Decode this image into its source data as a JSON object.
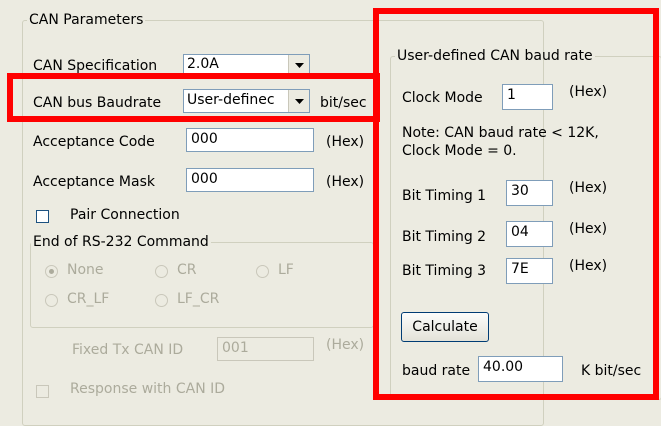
{
  "can_params": {
    "legend": "CAN Parameters",
    "spec_label": "CAN Specification",
    "spec_value": "2.0A",
    "baud_label": "CAN bus Baudrate",
    "baud_value": "User-definec",
    "baud_unit": "bit/sec",
    "acc_code_label": "Acceptance Code",
    "acc_code_value": "000",
    "acc_mask_label": "Acceptance Mask",
    "acc_mask_value": "000",
    "hex_unit": "(Hex)",
    "pair_label": "Pair Connection",
    "rs232": {
      "legend": "End of RS-232 Command",
      "opt_none": "None",
      "opt_cr": "CR",
      "opt_lf": "LF",
      "opt_cr_lf": "CR_LF",
      "opt_lf_cr": "LF_CR"
    },
    "fixed_tx_label": "Fixed Tx CAN ID",
    "fixed_tx_value": "001",
    "response_label": "Response with CAN ID"
  },
  "user_baud": {
    "legend": "User-defined CAN baud rate",
    "clock_label": "Clock Mode",
    "clock_value": "1",
    "hex_unit": "(Hex)",
    "note": "Note: CAN baud rate < 12K,\nClock Mode = 0.",
    "bt1_label": "Bit Timing 1",
    "bt1_value": "30",
    "bt2_label": "Bit Timing 2",
    "bt2_value": "04",
    "bt3_label": "Bit Timing 3",
    "bt3_value": "7E",
    "calc_label": "Calculate",
    "baud_label": "baud rate",
    "baud_value": "40.00",
    "baud_unit": "K bit/sec"
  },
  "colors": {
    "highlight": "#ff0000",
    "background": "#ecebe1"
  }
}
